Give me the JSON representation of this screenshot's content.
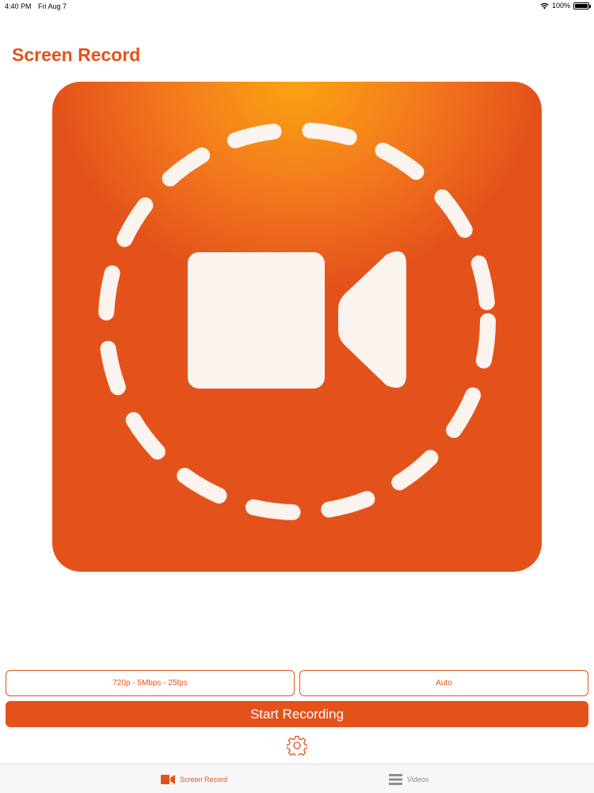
{
  "status_bar": {
    "time": "4:40 PM",
    "date": "Fri Aug 7",
    "battery": "100%",
    "battery_level": 1.0,
    "icons": [
      "wifi-icon",
      "battery-icon"
    ]
  },
  "header": {
    "title": "Screen Record"
  },
  "hero": {
    "icon": "video-camera-icon",
    "ring": "dashed-circle"
  },
  "settings": {
    "quality_label": "720p - 5Mbps - 25fps",
    "mode_label": "Auto"
  },
  "actions": {
    "start_label": "Start Recording",
    "settings_icon": "gear-icon"
  },
  "tab_bar": {
    "tabs": [
      {
        "label": "Screen Record",
        "icon": "video-camera-icon",
        "selected": true
      },
      {
        "label": "Videos",
        "icon": "list-icon",
        "selected": false
      }
    ]
  },
  "colors": {
    "accent": "#E4521C",
    "gradient_highlight": "#FBA313",
    "tab_inactive": "#8E8E93"
  }
}
